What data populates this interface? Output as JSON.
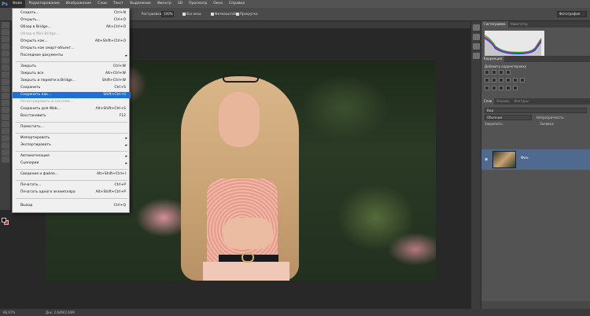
{
  "menubar": {
    "logo": "Ps",
    "items": [
      "Файл",
      "Редактирование",
      "Изображение",
      "Слои",
      "Текст",
      "Выделение",
      "Фильтр",
      "3D",
      "Просмотр",
      "Окно",
      "Справка"
    ]
  },
  "options": {
    "feather_label": "Растушевка:",
    "zoom_value": "100%",
    "chk1": "Все окна",
    "chk2": "Фитмасштаб",
    "chk3": "Прокрутка",
    "workspace": "Фотография"
  },
  "file_menu": [
    {
      "label": "Создать...",
      "shortcut": "Ctrl+N",
      "state": "normal"
    },
    {
      "label": "Открыть...",
      "shortcut": "Ctrl+O",
      "state": "normal"
    },
    {
      "label": "Обзор в Bridge...",
      "shortcut": "Alt+Ctrl+O",
      "state": "normal"
    },
    {
      "label": "Обзор в Mini Bridge...",
      "shortcut": "",
      "state": "disabled"
    },
    {
      "label": "Открыть как...",
      "shortcut": "Alt+Shift+Ctrl+O",
      "state": "normal"
    },
    {
      "label": "Открыть как смарт-объект...",
      "shortcut": "",
      "state": "normal"
    },
    {
      "label": "Последние документы",
      "shortcut": "",
      "state": "sub"
    },
    {
      "label": "Закрыть",
      "shortcut": "Ctrl+W",
      "state": "normal"
    },
    {
      "label": "Закрыть все",
      "shortcut": "Alt+Ctrl+W",
      "state": "normal"
    },
    {
      "label": "Закрыть и перейти в Bridge...",
      "shortcut": "Shift+Ctrl+W",
      "state": "normal"
    },
    {
      "label": "Сохранить",
      "shortcut": "Ctrl+S",
      "state": "normal"
    },
    {
      "label": "Сохранить как...",
      "shortcut": "Shift+Ctrl+S",
      "state": "highlighted"
    },
    {
      "label": "Регистрировать в системе...",
      "shortcut": "",
      "state": "disabled"
    },
    {
      "label": "Сохранить для Web...",
      "shortcut": "Alt+Shift+Ctrl+S",
      "state": "normal"
    },
    {
      "label": "Восстановить",
      "shortcut": "F12",
      "state": "normal"
    },
    {
      "label": "Поместить...",
      "shortcut": "",
      "state": "normal"
    },
    {
      "label": "Импортировать",
      "shortcut": "",
      "state": "sub"
    },
    {
      "label": "Экспортировать",
      "shortcut": "",
      "state": "sub"
    },
    {
      "label": "Автоматизация",
      "shortcut": "",
      "state": "sub"
    },
    {
      "label": "Сценарии",
      "shortcut": "",
      "state": "sub"
    },
    {
      "label": "Сведения о файле...",
      "shortcut": "Alt+Shift+Ctrl+I",
      "state": "normal"
    },
    {
      "label": "Печатать...",
      "shortcut": "Ctrl+P",
      "state": "normal"
    },
    {
      "label": "Печатать одного экземпляра",
      "shortcut": "Alt+Shift+Ctrl+P",
      "state": "normal"
    },
    {
      "label": "Выход",
      "shortcut": "Ctrl+Q",
      "state": "normal"
    }
  ],
  "panels": {
    "top_tabs": [
      "Гистограмма",
      "Навигатор"
    ],
    "adjust_tab": "Коррекция",
    "adjust_label": "Добавить корректировку",
    "layers_tabs": [
      "Слои",
      "Каналы",
      "Контуры"
    ],
    "kind_label": "Вид",
    "blend_mode": "Обычные",
    "opacity_label": "Непрозрачность:",
    "lock_label": "Закрепить:",
    "fill_label": "Заливка:",
    "layer_name": "Фон"
  },
  "status": {
    "zoom": "66,67%",
    "doc": "Док: 2,64M/2,64M"
  },
  "colors": {
    "highlight": "#1e6fd9",
    "layer_selected": "#4f6a8e",
    "background_swatch": "#e02020"
  }
}
